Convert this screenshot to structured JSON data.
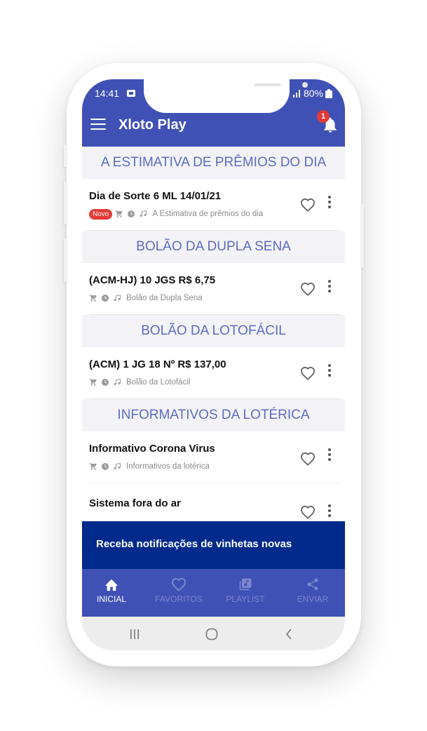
{
  "status_bar": {
    "time": "14:41",
    "battery": "80%"
  },
  "app_bar": {
    "title": "Xloto Play",
    "notification_count": "1"
  },
  "sections": [
    {
      "header": "A ESTIMATIVA DE PRÊMIOS DO DIA",
      "items": [
        {
          "title": "Dia de Sorte 6 ML 14/01/21",
          "badge": "Novo",
          "category": "A Estimativa de prêmios do dia"
        }
      ]
    },
    {
      "header": "BOLÃO DA DUPLA SENA",
      "items": [
        {
          "title": "(ACM-HJ) 10 JGS R$ 6,75",
          "category": "Bolão da Dupla Sena"
        }
      ]
    },
    {
      "header": "BOLÃO DA LOTOFÁCIL",
      "items": [
        {
          "title": "(ACM) 1 JG 18 Nº R$ 137,00",
          "category": "Bolão da Lotofácil"
        }
      ]
    },
    {
      "header": "INFORMATIVOS DA LOTÉRICA",
      "items": [
        {
          "title": "Informativo Corona Virus",
          "category": "Informativos da lotérica"
        },
        {
          "title": "Sistema fora do ar"
        }
      ]
    }
  ],
  "banner": {
    "text": "Receba notificações de vinhetas novas"
  },
  "bottom_nav": {
    "active": "INICIAL",
    "items": [
      {
        "label": "INICIAL",
        "icon": "home-icon"
      },
      {
        "label": "FAVORITOS",
        "icon": "heart-icon"
      },
      {
        "label": "PLAYLIST",
        "icon": "playlist-icon"
      },
      {
        "label": "ENVIAR",
        "icon": "share-icon"
      }
    ]
  },
  "system_nav": {
    "icons": [
      "recent-apps-icon",
      "home-circle-icon",
      "back-icon"
    ]
  },
  "colors": {
    "primary": "#3f51b5",
    "banner": "#002a8b",
    "accent": "#5c6bc0",
    "badge": "#e53935"
  }
}
